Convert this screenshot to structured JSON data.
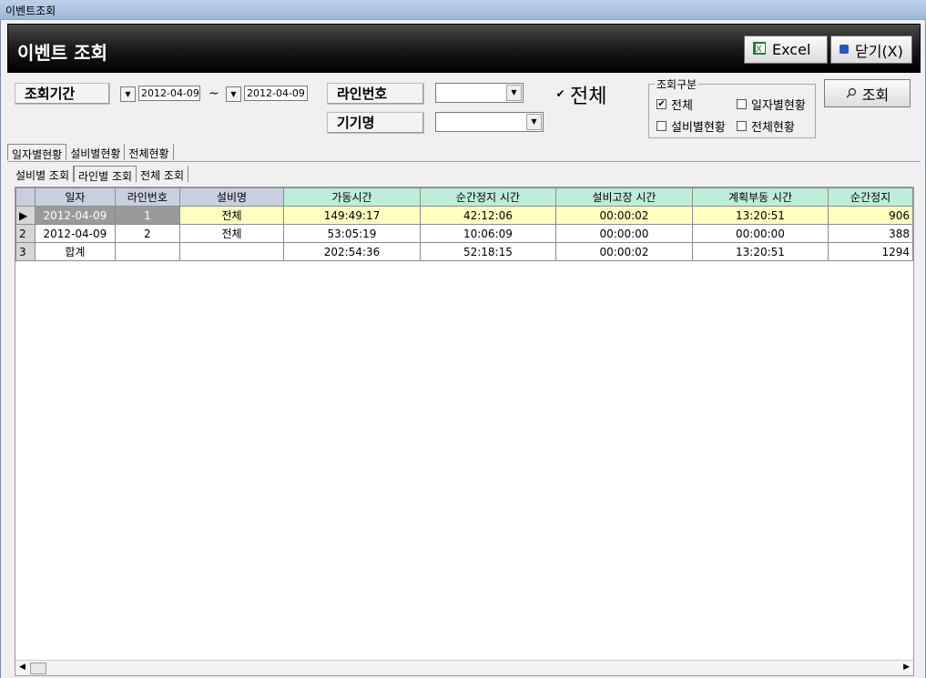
{
  "window_title": "이벤트조회",
  "header": {
    "title": "이벤트 조회",
    "excel_label": "Excel",
    "close_label": "닫기(X)"
  },
  "filters": {
    "period_label": "조회기간",
    "date_from": "2012-04-09",
    "tilde": "~",
    "date_to": "2012-04-09",
    "line_label": "라인번호",
    "device_label": "기기명",
    "all_label": "전체",
    "all_checked": true
  },
  "group": {
    "legend": "조회구분",
    "options": [
      {
        "label": "전체",
        "checked": true
      },
      {
        "label": "일자별현황",
        "checked": false
      },
      {
        "label": "설비별현황",
        "checked": false
      },
      {
        "label": "전체현황",
        "checked": false
      }
    ]
  },
  "search_label": "조회",
  "tabs_top": [
    "일자별현황",
    "설비별현황",
    "전체현황"
  ],
  "tabs_sub": [
    "설비별 조회",
    "라인별 조회",
    "전체 조회"
  ],
  "grid": {
    "columns": [
      "일자",
      "라인번호",
      "설비명",
      "가동시간",
      "순간정지 시간",
      "설비고장 시간",
      "계획부동 시간",
      "순간정지 "
    ],
    "rows": [
      {
        "num": "",
        "cells": [
          "2012-04-09",
          "1",
          "전체",
          "149:49:17",
          "42:12:06",
          "00:00:02",
          "13:20:51",
          "906"
        ]
      },
      {
        "num": "2",
        "cells": [
          "2012-04-09",
          "2",
          "전체",
          "53:05:19",
          "10:06:09",
          "00:00:00",
          "00:00:00",
          "388"
        ]
      },
      {
        "num": "3",
        "cells": [
          "합계",
          "",
          "",
          "202:54:36",
          "52:18:15",
          "00:00:02",
          "13:20:51",
          "1294"
        ]
      }
    ]
  }
}
